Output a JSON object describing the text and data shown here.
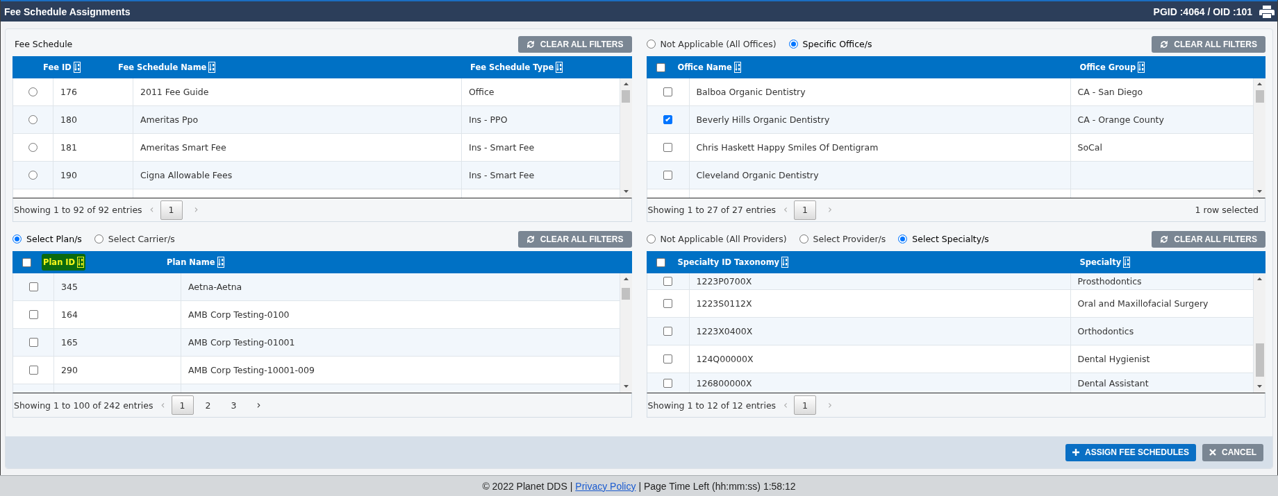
{
  "window": {
    "title": "Fee Schedule Assignments",
    "ids": "PGID :4064 / OID :101"
  },
  "panels": [
    {
      "kind": "radio",
      "heading": "Fee Schedule",
      "clear_button": "CLEAR ALL FILTERS",
      "columns": [
        {
          "label": "Fee ID",
          "highlighted": false
        },
        {
          "label": "Fee Schedule Name",
          "highlighted": false
        },
        {
          "label": "Fee Schedule Type",
          "highlighted": false
        }
      ],
      "rows": [
        {
          "cells": [
            "176",
            "2011 Fee Guide",
            "Office"
          ],
          "selected": false
        },
        {
          "cells": [
            "180",
            "Ameritas Ppo",
            "Ins - PPO"
          ],
          "selected": false
        },
        {
          "cells": [
            "181",
            "Ameritas Smart Fee",
            "Ins - Smart Fee"
          ],
          "selected": false
        },
        {
          "cells": [
            "190",
            "Cigna Allowable Fees",
            "Ins - Smart Fee"
          ],
          "selected": false
        }
      ],
      "summary": "Showing 1 to 92 of 92 entries",
      "prev": {
        "label": "‹",
        "disabled": true
      },
      "pages": [
        {
          "label": "1",
          "selected": true
        }
      ],
      "next": {
        "label": "›",
        "disabled": true
      }
    },
    {
      "kind": "checkbox",
      "options": [
        {
          "label": "Not Applicable (All Offices)",
          "selected": false
        },
        {
          "label": "Specific Office/s",
          "selected": true
        }
      ],
      "clear_button": "CLEAR ALL FILTERS",
      "select_all": {
        "checked": false
      },
      "columns": [
        {
          "label": "Office Name",
          "highlighted": false
        },
        {
          "label": "Office Group",
          "highlighted": false
        }
      ],
      "rows": [
        {
          "cells": [
            "Balboa Organic Dentistry",
            "CA - San Diego"
          ],
          "checked": false
        },
        {
          "cells": [
            "Beverly Hills Organic Dentistry",
            "CA - Orange County"
          ],
          "checked": true
        },
        {
          "cells": [
            "Chris Haskett Happy Smiles Of Dentigram",
            "SoCal"
          ],
          "checked": false
        },
        {
          "cells": [
            "Cleveland Organic Dentistry"
          ],
          "checked": false
        }
      ],
      "summary": "Showing 1 to 27 of 27 entries",
      "prev": {
        "label": "‹",
        "disabled": true
      },
      "pages": [
        {
          "label": "1",
          "selected": true
        }
      ],
      "next": {
        "label": "›",
        "disabled": true
      },
      "selection_info": "1 row selected"
    },
    {
      "kind": "checkbox",
      "options": [
        {
          "label": "Select Plan/s",
          "selected": true
        },
        {
          "label": "Select Carrier/s",
          "selected": false
        }
      ],
      "clear_button": "CLEAR ALL FILTERS",
      "select_all": {
        "checked": false
      },
      "columns": [
        {
          "label": "Plan ID",
          "highlighted": true
        },
        {
          "label": "Plan Name",
          "highlighted": false
        }
      ],
      "rows": [
        {
          "cells": [
            "345",
            "Aetna-Aetna"
          ],
          "checked": false
        },
        {
          "cells": [
            "164",
            "AMB Corp Testing-0100"
          ],
          "checked": false
        },
        {
          "cells": [
            "165",
            "AMB Corp Testing-01001"
          ],
          "checked": false
        },
        {
          "cells": [
            "290",
            "AMB Corp Testing-10001-009"
          ],
          "checked": false
        }
      ],
      "summary": "Showing 1 to 100 of 242 entries",
      "prev": {
        "label": "‹",
        "disabled": true
      },
      "pages": [
        {
          "label": "1",
          "selected": true
        },
        {
          "label": "2",
          "selected": false
        },
        {
          "label": "3",
          "selected": false
        }
      ],
      "next": {
        "label": "›",
        "disabled": false
      }
    },
    {
      "kind": "checkbox",
      "options": [
        {
          "label": "Not Applicable (All Providers)",
          "selected": false
        },
        {
          "label": "Select Provider/s",
          "selected": false
        },
        {
          "label": "Select Specialty/s",
          "selected": true
        }
      ],
      "clear_button": "CLEAR ALL FILTERS",
      "select_all": {
        "checked": false
      },
      "columns": [
        {
          "label": "Specialty ID Taxonomy",
          "highlighted": false
        },
        {
          "label": "Specialty",
          "highlighted": false
        }
      ],
      "rows": [
        {
          "cells": [
            "1223P0700X",
            "Prosthodontics"
          ],
          "checked": false
        },
        {
          "cells": [
            "1223S0112X",
            "Oral and Maxillofacial Surgery"
          ],
          "checked": false
        },
        {
          "cells": [
            "1223X0400X",
            "Orthodontics"
          ],
          "checked": false
        },
        {
          "cells": [
            "124Q00000X",
            "Dental Hygienist"
          ],
          "checked": false
        },
        {
          "cells": [
            "126800000X",
            "Dental Assistant"
          ],
          "checked": false
        }
      ],
      "summary": "Showing 1 to 12 of 12 entries",
      "prev": {
        "label": "‹",
        "disabled": true
      },
      "pages": [
        {
          "label": "1",
          "selected": true
        }
      ],
      "next": {
        "label": "›",
        "disabled": true
      }
    }
  ],
  "actions": [
    {
      "label": "ASSIGN FEE SCHEDULES",
      "kind": "primary"
    },
    {
      "label": "CANCEL",
      "kind": "secondary"
    }
  ],
  "footer": {
    "items": [
      {
        "kind": "text",
        "text": "© 2022 Planet DDS |"
      },
      {
        "kind": "link",
        "text": "Privacy Policy"
      },
      {
        "kind": "text",
        "text": "| Page Time Left (hh:mm:ss) 1:58:12"
      }
    ]
  }
}
